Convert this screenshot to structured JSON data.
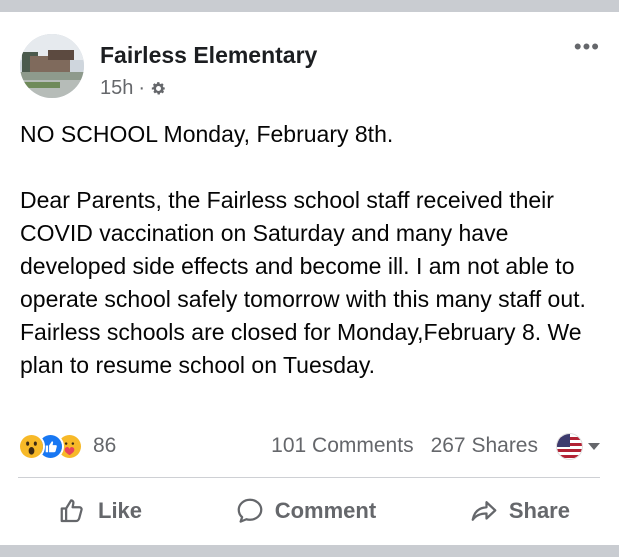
{
  "post": {
    "page_name": "Fairless Elementary",
    "timestamp": "15h",
    "separator": "·",
    "audience_icon": "gear-icon",
    "more_icon": "more-options-icon",
    "more_label": "•••",
    "paragraphs": [
      "NO SCHOOL Monday, February 8th.",
      "Dear Parents, the Fairless school staff received their COVID vaccination on Saturday and many have developed side effects and become ill.  I am not able to operate school safely tomorrow with this many staff out. Fairless schools are closed for Monday,February 8. We plan to resume school on Tuesday."
    ]
  },
  "stats": {
    "reactions": [
      "wow-reaction-icon",
      "like-reaction-icon",
      "care-reaction-icon"
    ],
    "reaction_count": "86",
    "comments": "101 Comments",
    "shares": "267 Shares"
  },
  "actions": {
    "like": "Like",
    "comment": "Comment",
    "share": "Share"
  },
  "colors": {
    "text": "#050505",
    "secondary": "#65676b",
    "like_blue": "#1877f2",
    "wow_yellow": "#f7b928"
  }
}
